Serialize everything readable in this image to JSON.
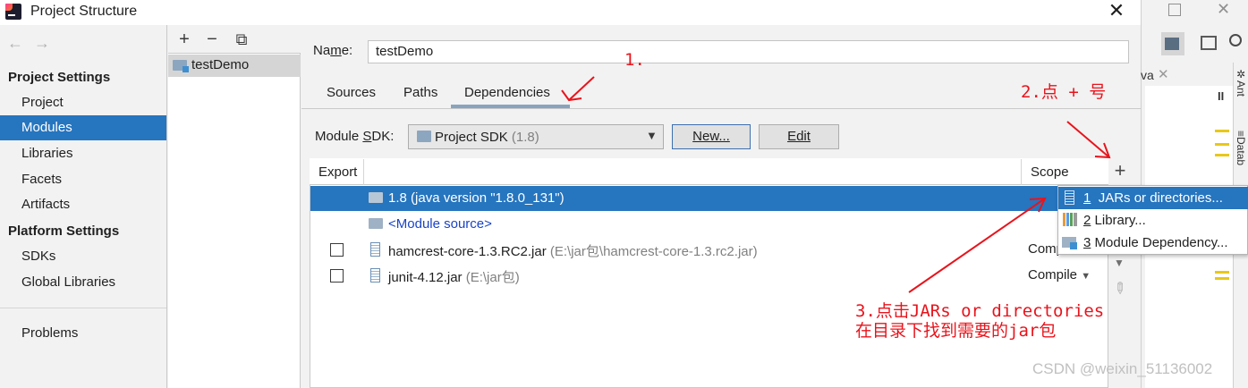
{
  "window": {
    "title": "Project Structure",
    "close_glyph": "✕"
  },
  "sidebar": {
    "back_glyph": "←",
    "forward_glyph": "→",
    "project_settings_header": "Project Settings",
    "project_settings_items": [
      {
        "label": "Project"
      },
      {
        "label": "Modules",
        "selected": true
      },
      {
        "label": "Libraries"
      },
      {
        "label": "Facets"
      },
      {
        "label": "Artifacts"
      }
    ],
    "platform_settings_header": "Platform Settings",
    "platform_settings_items": [
      {
        "label": "SDKs"
      },
      {
        "label": "Global Libraries"
      }
    ],
    "problems_label": "Problems"
  },
  "module_list": {
    "add_glyph": "+",
    "remove_glyph": "−",
    "copy_glyph": "⧉",
    "modules": [
      "testDemo"
    ]
  },
  "module": {
    "name_label": "Name:",
    "name_value": "testDemo",
    "tabs": [
      "Sources",
      "Paths",
      "Dependencies"
    ],
    "active_tab": "Dependencies",
    "sdk_label": "Module SDK:",
    "sdk_value": "Project SDK",
    "sdk_version": "(1.8)",
    "new_button": "New...",
    "edit_button": "Edit"
  },
  "dependencies": {
    "col_export": "Export",
    "col_scope": "Scope",
    "add_glyph": "+",
    "rows": [
      {
        "name": "1.8 (java version \"1.8.0_131\")",
        "path": "",
        "scope": "",
        "selected": true
      },
      {
        "name": "<Module source>",
        "path": "",
        "scope": ""
      },
      {
        "name": "hamcrest-core-1.3.RC2.jar",
        "path": "(E:\\jar包\\hamcrest-core-1.3.rc2.jar)",
        "scope": "Comp"
      },
      {
        "name": "junit-4.12.jar",
        "path": "(E:\\jar包)",
        "scope": "Compile"
      }
    ]
  },
  "add_popup": {
    "items": [
      {
        "number": "1",
        "label": "JARs or directories...",
        "selected": true
      },
      {
        "number": "2",
        "label": "Library..."
      },
      {
        "number": "3",
        "label": "Module Dependency..."
      }
    ]
  },
  "background_ide": {
    "tab_fragment": "va",
    "side_tabs": [
      "Ant",
      "Datab"
    ]
  },
  "annotations": {
    "step1": "1.",
    "step2": "2.点 + 号",
    "step3_line1": "3.点击JARs or directories",
    "step3_line2": "在目录下找到需要的jar包",
    "color": "#e8141c"
  },
  "watermark": "CSDN @weixin_51136002"
}
